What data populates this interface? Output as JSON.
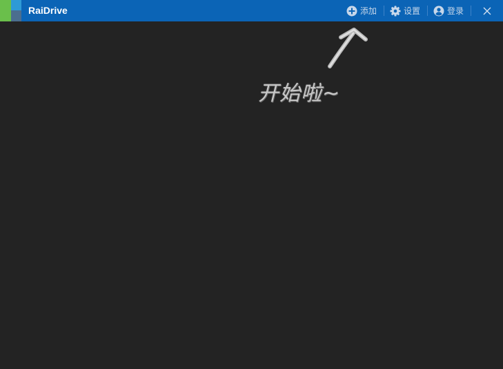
{
  "app": {
    "title": "RaiDrive"
  },
  "toolbar": {
    "add_label": "添加",
    "settings_label": "设置",
    "login_label": "登录"
  },
  "main": {
    "hint_text": "开始啦~"
  },
  "colors": {
    "titlebar": "#0b64b6",
    "background": "#232323",
    "logo_green": "#6abf4b",
    "logo_teal": "#2e9ad6",
    "logo_slate": "#4b6e8f"
  }
}
